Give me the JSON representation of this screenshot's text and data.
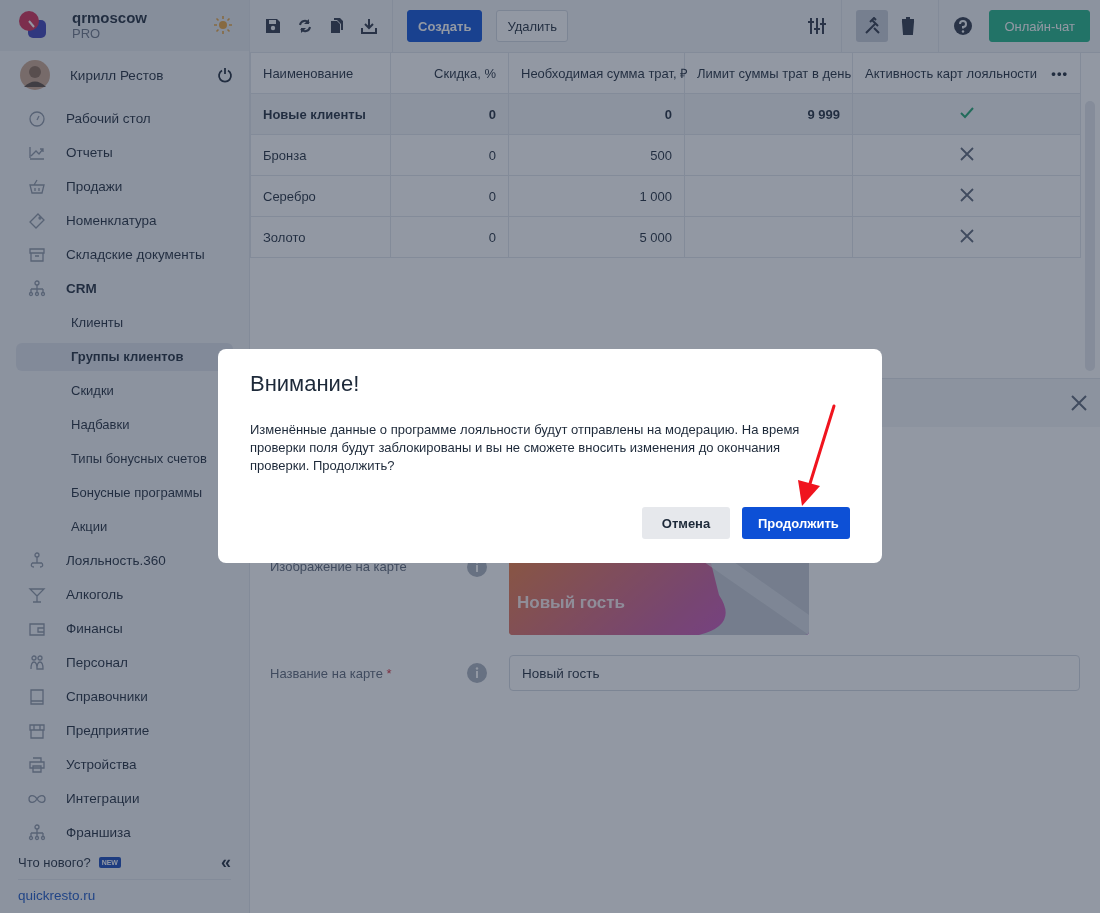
{
  "brand": {
    "name": "qrmoscow",
    "plan": "PRO"
  },
  "user": {
    "name": "Кирилл Рестов"
  },
  "nav": [
    {
      "label": "Рабочий стол",
      "expanded": false
    },
    {
      "label": "Отчеты",
      "expanded": false
    },
    {
      "label": "Продажи",
      "expanded": false
    },
    {
      "label": "Номенклатура",
      "expanded": false
    },
    {
      "label": "Складские документы",
      "expanded": false
    },
    {
      "label": "CRM",
      "expanded": true,
      "children": [
        {
          "label": "Клиенты",
          "selected": false
        },
        {
          "label": "Группы клиентов",
          "selected": true
        },
        {
          "label": "Скидки",
          "selected": false
        },
        {
          "label": "Надбавки",
          "selected": false
        },
        {
          "label": "Типы бонусных счетов",
          "selected": false
        },
        {
          "label": "Бонусные программы",
          "selected": false
        },
        {
          "label": "Акции",
          "selected": false
        }
      ]
    },
    {
      "label": "Лояльность.360",
      "expanded": false
    },
    {
      "label": "Алкоголь",
      "expanded": false
    },
    {
      "label": "Финансы",
      "expanded": false
    },
    {
      "label": "Персонал",
      "expanded": false
    },
    {
      "label": "Справочники",
      "expanded": false
    },
    {
      "label": "Предприятие",
      "expanded": false
    },
    {
      "label": "Устройства",
      "expanded": false
    },
    {
      "label": "Интеграции",
      "expanded": false
    },
    {
      "label": "Франшиза",
      "expanded": false
    }
  ],
  "footer": {
    "whats_new": "Что нового?",
    "badge": "NEW",
    "collapse": "«",
    "link": "quickresto.ru"
  },
  "toolbar": {
    "create": "Создать",
    "delete": "Удалить",
    "chat": "Онлайн-чат",
    "tools": [
      {
        "selected": true
      },
      {
        "selected": false
      }
    ]
  },
  "table": {
    "columns": [
      "Наименование",
      "Скидка, %",
      "Необходимая сумма трат, ₽",
      "Лимит суммы трат в день",
      "Активность карт лояльности"
    ],
    "more": "•••",
    "rows": [
      {
        "cells": [
          "Новые клиенты",
          "0",
          "0",
          "9 999"
        ],
        "active": true,
        "selected": true
      },
      {
        "cells": [
          "Бронза",
          "0",
          "500"
        ],
        "active": false,
        "selected": false
      },
      {
        "cells": [
          "Серебро",
          "0",
          "1 000"
        ],
        "active": false,
        "selected": false
      },
      {
        "cells": [
          "Золото",
          "0",
          "5 000"
        ],
        "active": false,
        "selected": false
      }
    ]
  },
  "panel": {
    "image_label": "Изображение на карте",
    "card_text": "Новый гость",
    "name_label": "Название на карте",
    "required_mark": "*",
    "name_value": "Новый гость"
  },
  "dialog": {
    "title": "Внимание!",
    "message": "Изменённые данные о программе лояльности будут отправлены на модерацию. На время проверки поля будут заблокированы и вы не сможете вносить изменения до окончания проверки. Продолжить?",
    "cancel": "Отмена",
    "confirm": "Продолжить"
  }
}
